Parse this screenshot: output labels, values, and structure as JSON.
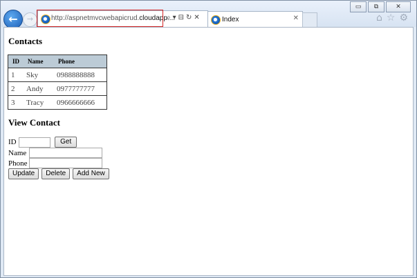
{
  "browser": {
    "address": {
      "url_prefix": "http://aspnetmvcwebapicrud.",
      "url_host": "cloudapp...."
    },
    "address_tools": [
      "⌕",
      "▾",
      "⊟",
      "↻",
      "✕"
    ],
    "tab": {
      "label": "Index",
      "close": "✕"
    },
    "window_buttons": {
      "minimize": "▭",
      "restore": "⧉",
      "close": "✕"
    },
    "toolbar_icons": {
      "home": "⌂",
      "favorites": "☆",
      "tools": "⚙"
    },
    "nav": {
      "back": "←",
      "forward": "→"
    }
  },
  "page": {
    "contacts_heading": "Contacts",
    "table": {
      "headers": [
        "ID",
        "Name",
        "Phone"
      ],
      "rows": [
        [
          "1",
          "Sky",
          "0988888888"
        ],
        [
          "2",
          "Andy",
          "0977777777"
        ],
        [
          "3",
          "Tracy",
          "0966666666"
        ]
      ]
    },
    "view_heading": "View Contact",
    "form": {
      "id_label": "ID",
      "id_value": "",
      "get_button": "Get",
      "name_label": "Name",
      "name_value": "",
      "phone_label": "Phone",
      "phone_value": ""
    },
    "buttons": {
      "update": "Update",
      "delete": "Delete",
      "add_new": "Add New"
    }
  }
}
